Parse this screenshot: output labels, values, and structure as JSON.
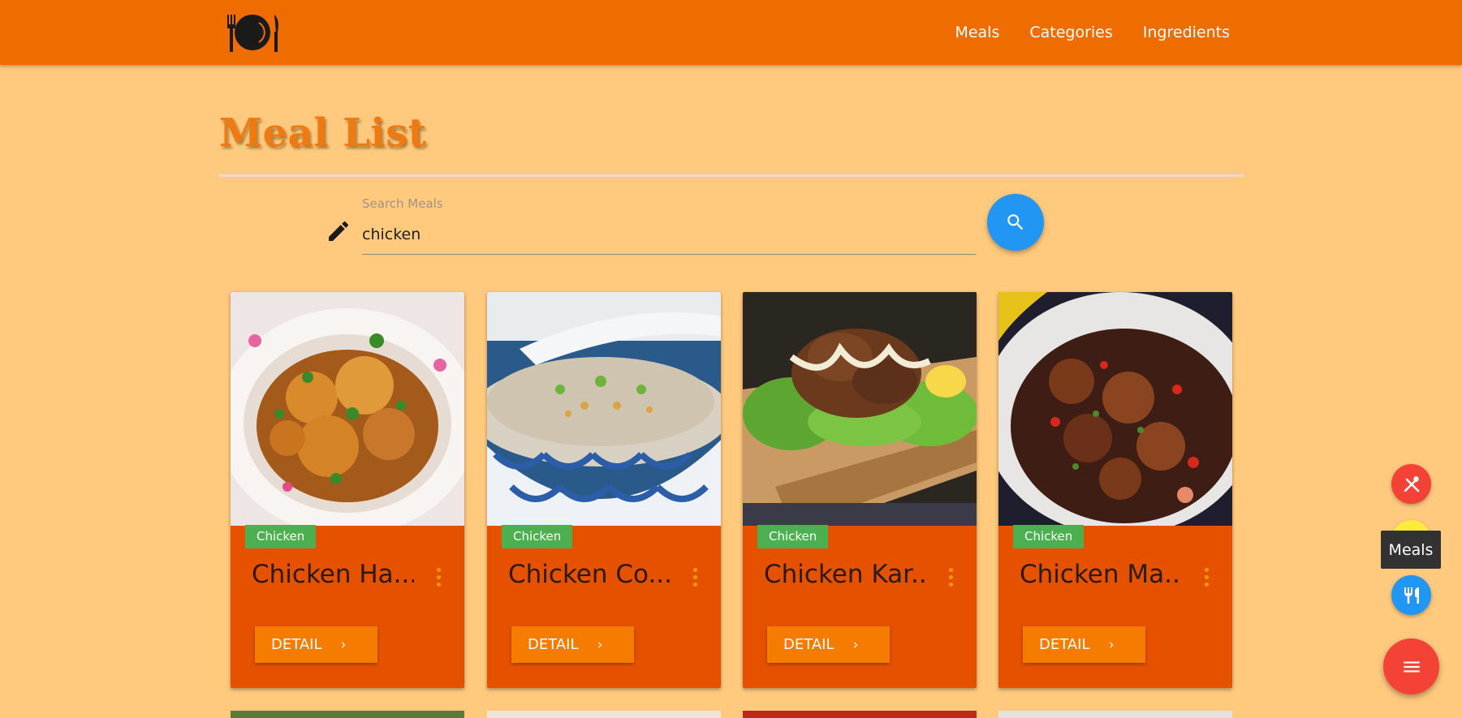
{
  "nav": {
    "links": [
      "Meals",
      "Categories",
      "Ingredients"
    ]
  },
  "page": {
    "title": "Meal List"
  },
  "search": {
    "label": "Search Meals",
    "value": "chicken"
  },
  "cards": [
    {
      "category": "Chicken",
      "title": "Chicken Ha...",
      "detail_label": "DETAIL"
    },
    {
      "category": "Chicken",
      "title": "Chicken Co...",
      "detail_label": "DETAIL"
    },
    {
      "category": "Chicken",
      "title": "Chicken Kar...",
      "detail_label": "DETAIL"
    },
    {
      "category": "Chicken",
      "title": "Chicken Ma...",
      "detail_label": "DETAIL"
    }
  ],
  "fab": {
    "tooltip": "Meals"
  },
  "colors": {
    "page_background": "#ffc97e",
    "navbar": "#ef6c00",
    "card": "#e65100",
    "badge": "#4caf50",
    "detail_button": "#f57c00",
    "search_button": "#2196f3",
    "fab_main": "#f44336"
  }
}
